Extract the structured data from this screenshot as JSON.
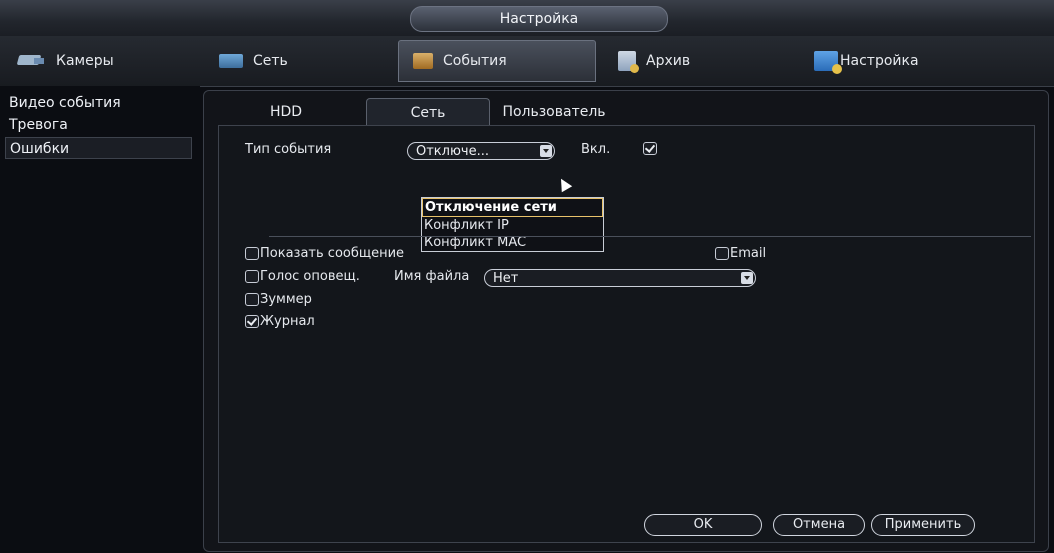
{
  "window": {
    "title": "Настройка"
  },
  "nav": {
    "tabs": [
      {
        "label": "Камеры",
        "icon": "camera-icon"
      },
      {
        "label": "Сеть",
        "icon": "network-icon"
      },
      {
        "label": "События",
        "icon": "events-icon",
        "active": true
      },
      {
        "label": "Архив",
        "icon": "archive-icon"
      },
      {
        "label": "Настройка",
        "icon": "settings-icon"
      }
    ]
  },
  "sidebar": {
    "items": [
      {
        "label": "Видео события"
      },
      {
        "label": "Тревога"
      },
      {
        "label": "Ошибки",
        "active": true
      }
    ]
  },
  "subtabs": [
    {
      "label": "HDD"
    },
    {
      "label": "Сеть",
      "active": true
    },
    {
      "label": "Пользователь"
    }
  ],
  "form": {
    "event_type_label": "Тип события",
    "event_type_value": "Отключе...",
    "enable_label": "Вкл.",
    "enable_checked": true,
    "event_type_options": [
      "Отключение сети",
      "Конфликт IP",
      "Конфликт MAC"
    ],
    "show_message_label": "Показать сообщение",
    "email_label": "Email",
    "voice_label": "Голос оповещ.",
    "file_name_label": "Имя файла",
    "file_name_value": "Нет",
    "buzzer_label": "Зуммер",
    "log_label": "Журнал",
    "log_checked": true
  },
  "buttons": {
    "ok": "OK",
    "cancel": "Отмена",
    "apply": "Применить"
  }
}
